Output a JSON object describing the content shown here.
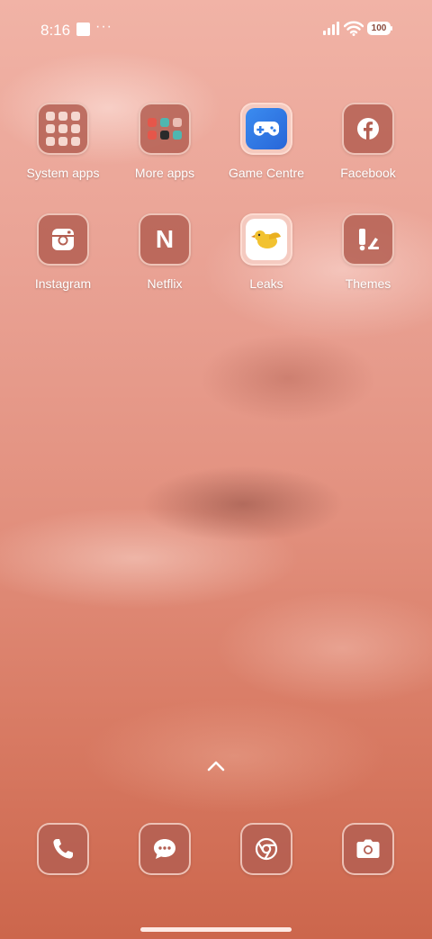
{
  "status_bar": {
    "time": "8:16",
    "more_indicator": "···",
    "battery_level": "100",
    "icons": [
      "notification-square-icon",
      "signal-icon",
      "wifi-icon",
      "battery-icon"
    ]
  },
  "apps": [
    {
      "label": "System apps",
      "icon": "folder-icon"
    },
    {
      "label": "More apps",
      "icon": "folder-icon"
    },
    {
      "label": "Game Centre",
      "icon": "gamepad-icon"
    },
    {
      "label": "Facebook",
      "icon": "facebook-icon"
    },
    {
      "label": "Instagram",
      "icon": "instagram-icon"
    },
    {
      "label": "Netflix",
      "icon": "netflix-icon"
    },
    {
      "label": "Leaks",
      "icon": "bird-icon"
    },
    {
      "label": "Themes",
      "icon": "brush-icon"
    }
  ],
  "netflix_letter": "N",
  "swipe_up": {
    "icon": "chevron-up-icon"
  },
  "dock": [
    {
      "icon": "phone-icon"
    },
    {
      "icon": "messages-icon"
    },
    {
      "icon": "chrome-icon"
    },
    {
      "icon": "camera-icon"
    }
  ],
  "colors": {
    "wallpaper_top": "#f1b3a6",
    "wallpaper_bottom": "#cc664c",
    "tile_bg": "#b45f52",
    "tile_border": "#ffe1d7",
    "game_centre_blue": "#2f7ae6",
    "leaks_yellow": "#f2c230"
  }
}
